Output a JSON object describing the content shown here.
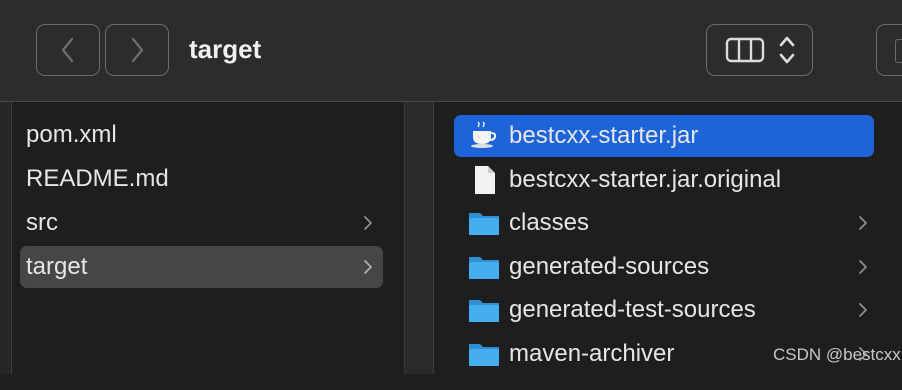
{
  "window": {
    "title": "target"
  },
  "toolbar": {
    "back_icon": "chevron-left-icon",
    "forward_icon": "chevron-right-icon",
    "view_icon": "column-view-icon",
    "view_chevrons_icon": "up-down-chevron-icon"
  },
  "columns": [
    {
      "items": [
        {
          "label": "pom.xml",
          "has_children": false,
          "selected": false
        },
        {
          "label": "README.md",
          "has_children": false,
          "selected": false
        },
        {
          "label": "src",
          "has_children": true,
          "selected": false
        },
        {
          "label": "target",
          "has_children": true,
          "selected": true
        }
      ]
    },
    {
      "items": [
        {
          "label": "bestcxx-starter.jar",
          "icon": "java-coffee-cup-icon",
          "has_children": false,
          "selected": true
        },
        {
          "label": "bestcxx-starter.jar.original",
          "icon": "document-icon",
          "has_children": false,
          "selected": false
        },
        {
          "label": "classes",
          "icon": "folder-icon",
          "has_children": true,
          "selected": false
        },
        {
          "label": "generated-sources",
          "icon": "folder-icon",
          "has_children": true,
          "selected": false
        },
        {
          "label": "generated-test-sources",
          "icon": "folder-icon",
          "has_children": true,
          "selected": false
        },
        {
          "label": "maven-archiver",
          "icon": "folder-icon",
          "has_children": true,
          "selected": false
        }
      ]
    }
  ],
  "colors": {
    "selection_active": "#1d64d9",
    "selection_inactive": "#464646",
    "folder": "#36a3e6"
  },
  "watermark": "CSDN @bestcxx"
}
